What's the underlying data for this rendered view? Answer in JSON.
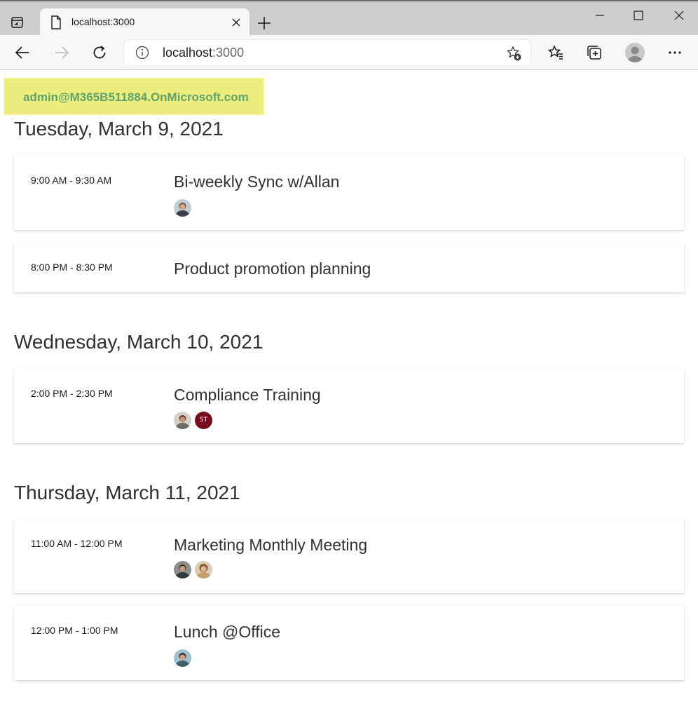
{
  "browser": {
    "tab_title": "localhost:3000",
    "url_host": "localhost",
    "url_port": ":3000"
  },
  "user": {
    "email": "admin@M365B511884.OnMicrosoft.com"
  },
  "days": [
    {
      "heading": "Tuesday, March 9, 2021",
      "events": [
        {
          "time": "9:00 AM - 9:30 AM",
          "subject": "Bi-weekly Sync w/Allan",
          "attendees": [
            "photo"
          ]
        },
        {
          "time": "8:00 PM - 8:30 PM",
          "subject": "Product promotion planning",
          "attendees": []
        }
      ]
    },
    {
      "heading": "Wednesday, March 10, 2021",
      "events": [
        {
          "time": "2:00 PM - 2:30 PM",
          "subject": "Compliance Training",
          "attendees": [
            "photo",
            "ST"
          ]
        }
      ]
    },
    {
      "heading": "Thursday, March 11, 2021",
      "events": [
        {
          "time": "11:00 AM - 12:00 PM",
          "subject": "Marketing Monthly Meeting",
          "attendees": [
            "photo",
            "photo"
          ]
        },
        {
          "time": "12:00 PM - 1:00 PM",
          "subject": "Lunch @Office",
          "attendees": [
            "photo"
          ]
        }
      ]
    }
  ],
  "colors": {
    "badge_bg": "#eded7e",
    "badge_text": "#5ea36c",
    "initials_avatar": "#750b1c"
  },
  "icons": [
    "tab-actions-icon",
    "page-icon",
    "close-icon",
    "plus-icon",
    "minimize-icon",
    "maximize-icon",
    "window-close-icon",
    "back-arrow-icon",
    "forward-arrow-icon",
    "refresh-icon",
    "info-icon",
    "add-favorite-icon",
    "favorites-icon",
    "collections-icon",
    "profile-icon",
    "more-icon"
  ]
}
